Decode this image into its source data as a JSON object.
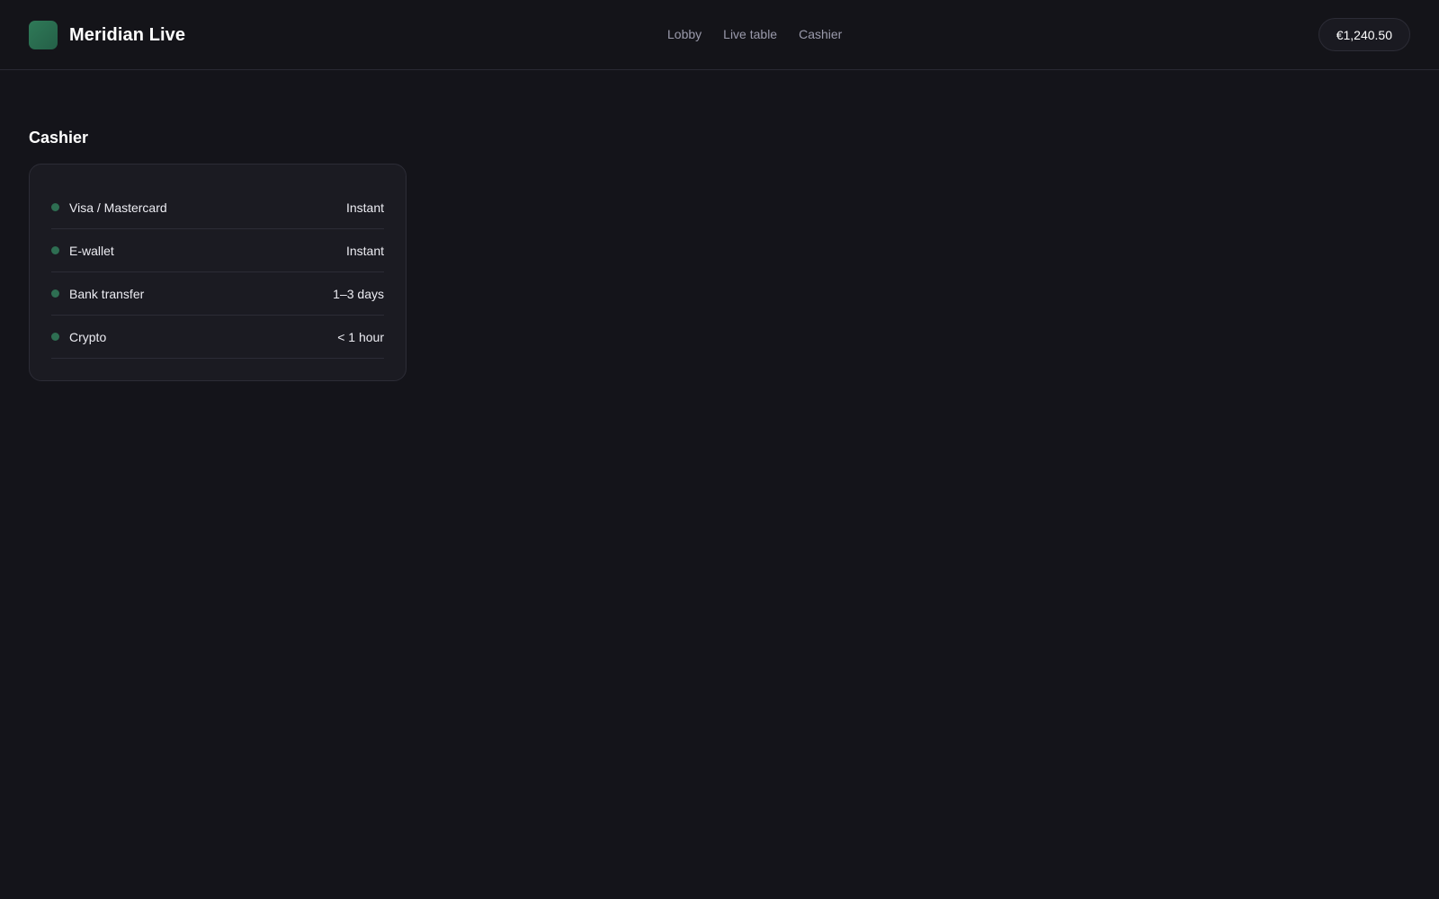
{
  "brand": {
    "name": "Meridian Live",
    "logo_color": "#2f7a58"
  },
  "nav": {
    "items": [
      {
        "label": "Lobby"
      },
      {
        "label": "Live table"
      },
      {
        "label": "Cashier"
      }
    ]
  },
  "wallet": {
    "balance": "€1,240.50"
  },
  "cashier": {
    "title": "Cashier",
    "status_color": "#2e6e52",
    "methods": [
      {
        "name": "Visa / Mastercard",
        "eta": "Instant"
      },
      {
        "name": "E-wallet",
        "eta": "Instant"
      },
      {
        "name": "Bank transfer",
        "eta": "1–3 days"
      },
      {
        "name": "Crypto",
        "eta": "< 1 hour"
      }
    ]
  }
}
